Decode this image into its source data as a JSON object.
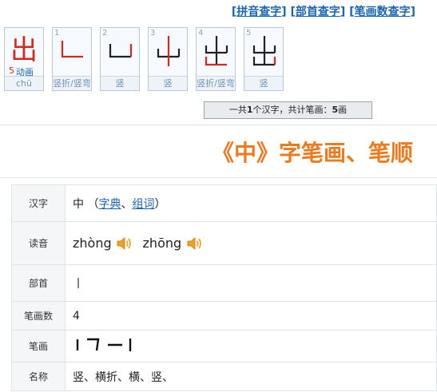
{
  "topnav": {
    "items": [
      "拼音查字",
      "部首查字",
      "笔画数查字"
    ]
  },
  "stroke_cards": {
    "main": {
      "glyph": "出",
      "count": "5",
      "anim_label": "动画",
      "pinyin": "chū"
    },
    "cards": [
      {
        "num": "1",
        "caption": "竖折/竖弯"
      },
      {
        "num": "2",
        "caption": "竖"
      },
      {
        "num": "3",
        "caption": "竖"
      },
      {
        "num": "4",
        "caption": "竖折/竖弯"
      },
      {
        "num": "5",
        "caption": "竖"
      }
    ]
  },
  "summary": {
    "prefix": "一共",
    "char_count": "1",
    "mid": "个汉字，共计笔画：",
    "stroke_total": "5",
    "suffix": "画"
  },
  "page_title": "《中》字笔画、笔顺",
  "info": {
    "char_label": "汉字",
    "char": "中",
    "open_paren": "（",
    "dict_link": "字典",
    "sep": "、",
    "word_link": "组词",
    "close_paren": "）",
    "reading_label": "读音",
    "readings": [
      "zhòng",
      "zhōng"
    ],
    "radical_label": "部首",
    "radical": "丨",
    "stroke_count_label": "笔画数",
    "stroke_count": "4",
    "strokes_label": "笔画",
    "strokes_glyphs": "丨 𠃍 一 丨",
    "names_label": "名称",
    "names": "竖、横折、横、竖、"
  },
  "colors": {
    "link": "#1a66b0",
    "title": "#ee7a1d",
    "stroke_highlight": "#d6291e"
  }
}
